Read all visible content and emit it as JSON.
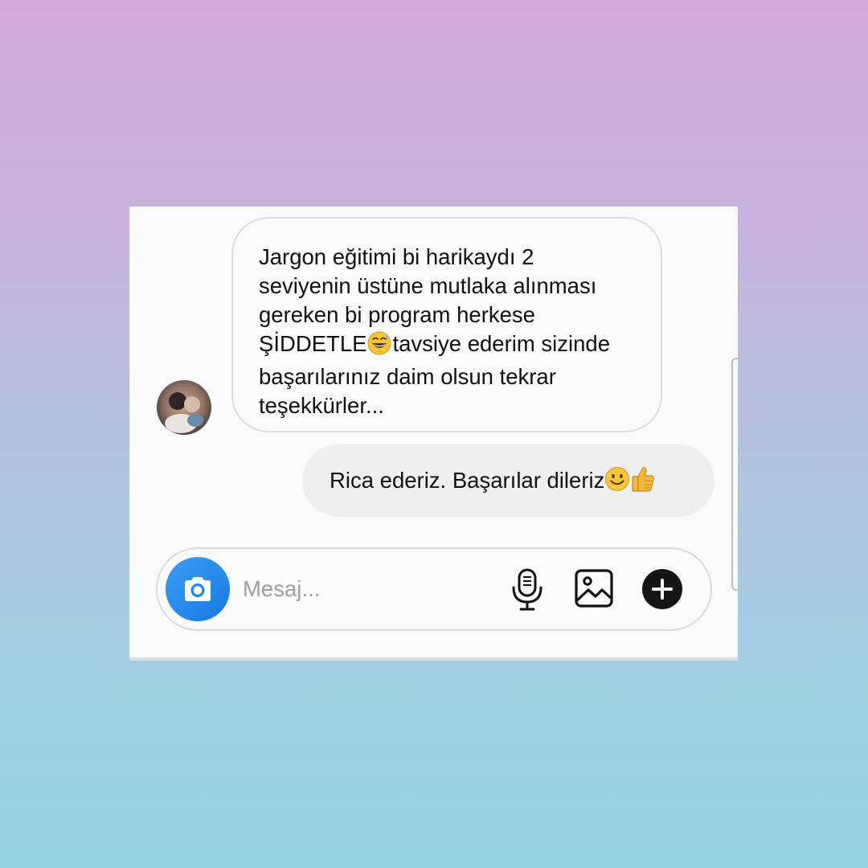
{
  "conversation": {
    "incoming": {
      "text": "Jargon eğitimi bi harikaydı 2\nseviyenin üstüne mutlaka alınması\ngereken bi program herkese\nŞİDDETLE",
      "emoji": "grinning-sweat-emoji",
      "text_after": "tavsiye ederim sizinde\nbaşarılarınız daim olsun tekrar\nteşekkürler..."
    },
    "outgoing": {
      "text": "Rica ederiz. Başarılar dileriz ",
      "emojis": [
        "slightly-smiling-face-emoji",
        "thumbs-up-emoji"
      ]
    }
  },
  "composer": {
    "placeholder": "Mesaj...",
    "value": "",
    "icons": {
      "camera": "camera-icon",
      "mic": "microphone-icon",
      "gallery": "image-icon",
      "plus": "plus-icon"
    },
    "accent": "#1f86ea"
  }
}
